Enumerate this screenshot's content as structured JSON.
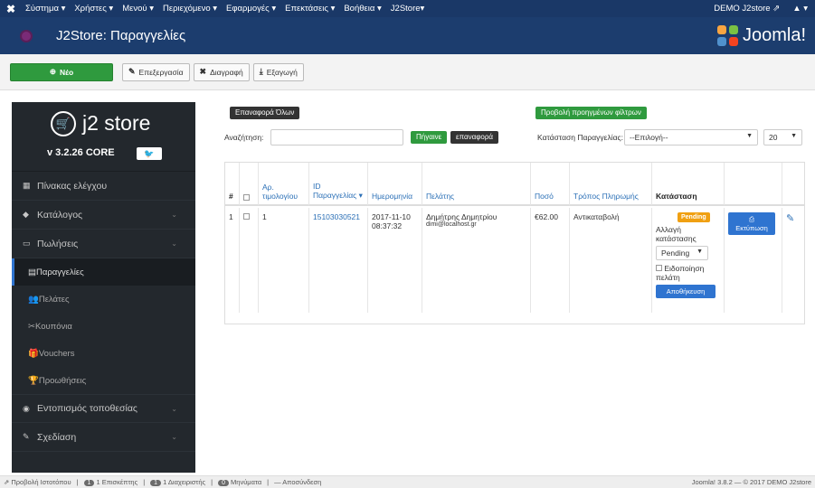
{
  "topnav": {
    "logo": "✖",
    "items": [
      "Σύστημα ▾",
      "Χρήστες ▾",
      "Μενού ▾",
      "Περιεχόμενο ▾",
      "Εφαρμογές ▾",
      "Επεκτάσεις ▾",
      "Βοήθεια ▾",
      "J2Store▾"
    ],
    "site_link": "DEMO J2store ⇗",
    "user": "▲ ▾"
  },
  "header": {
    "title": "J2Store: Παραγγελίες",
    "brand": "Joomla!"
  },
  "toolbar": {
    "new_label": "Νέο",
    "edit_label": "Επεξεργασία",
    "delete_label": "Διαγραφή",
    "export_label": "Εξαγωγή"
  },
  "sidebar": {
    "brand_name": "j2 store",
    "version": "v 3.2.26 CORE",
    "twitter": "🐦",
    "items": [
      {
        "label": "Πίνακας ελέγχου",
        "icon": "dashboard-icon"
      },
      {
        "label": "Κατάλογος",
        "icon": "tag-icon"
      },
      {
        "label": "Πωλήσεις",
        "icon": "sales-icon"
      },
      {
        "label": "Παραγγελίες",
        "icon": "orders-icon"
      },
      {
        "label": "Πελάτες",
        "icon": "customers-icon"
      },
      {
        "label": "Κουπόνια",
        "icon": "coupons-icon"
      },
      {
        "label": "Vouchers",
        "icon": "vouchers-icon"
      },
      {
        "label": "Προωθήσεις",
        "icon": "promotions-icon"
      },
      {
        "label": "Εντοπισμός τοποθεσίας",
        "icon": "globe-icon"
      },
      {
        "label": "Σχεδίαση",
        "icon": "design-icon"
      }
    ]
  },
  "filters": {
    "reset_all": "Επαναφορά Όλων",
    "advanced": "Προβολή προηγμένων φίλτρων",
    "search_label": "Αναζήτηση:",
    "search_value": "",
    "go": "Πήγαινε",
    "reset": "επαναφορά",
    "status_label": "Κατάσταση Παραγγελίας:",
    "status_value": "--Επιλογή--",
    "limit_value": "20"
  },
  "table": {
    "headers": [
      "#",
      "",
      "Αρ. τιμολογίου",
      "ID Παραγγελίας ▾",
      "Ημερομηνία",
      "Πελάτης",
      "Ποσό",
      "Τρόπος Πληρωμής",
      "Κατάσταση"
    ],
    "row": {
      "num": "1",
      "invoice": "1",
      "order_id": "15103030521",
      "date": "2017-11-10 08:37:32",
      "customer": "Δημήτρης Δημητρίου",
      "email": "dimi@localhost.gr",
      "amount": "€62.00",
      "payment": "Αντικαταβολή",
      "status_badge": "Pending",
      "change_label": "Αλλαγή κατάστασης",
      "status_select": "Pending",
      "notify_label": "Ειδοποίηση πελάτη",
      "save_label": "Αποθήκευση",
      "print_label": "Εκτύπωση"
    }
  },
  "footer": {
    "view_site": "Προβολή Ιστοτόπου",
    "visitors": "1 Επισκέπτης",
    "visitors_count": "1",
    "admins": "1 Διαχειριστής",
    "admins_count": "1",
    "messages": "Μηνύματα",
    "messages_count": "0",
    "logout": "Αποσύνδεση",
    "version": "Joomla! 3.8.2 — © 2017 DEMO J2store"
  }
}
